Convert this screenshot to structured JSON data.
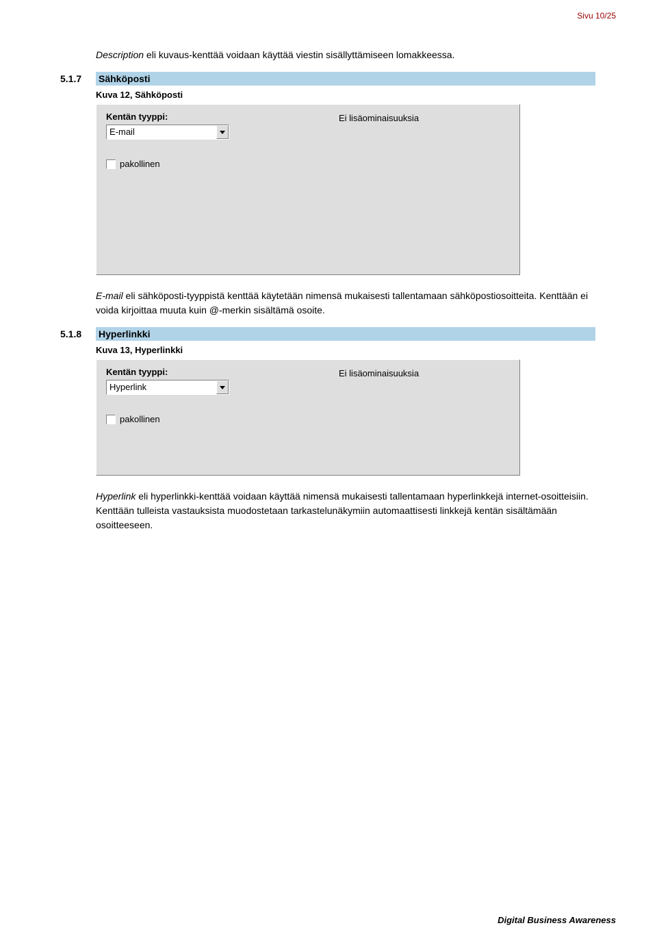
{
  "page_number": "Sivu 10/25",
  "intro_paragraph": {
    "italic": "Description",
    "rest": " eli kuvaus-kenttää voidaan käyttää viestin sisällyttämiseen lomakkeessa."
  },
  "sections": [
    {
      "number": "5.1.7",
      "title": "Sähköposti",
      "caption": "Kuva 12, Sähköposti",
      "panel": {
        "field_label": "Kentän tyyppi:",
        "select_value": "E-mail",
        "checkbox_label": "pakollinen",
        "right_text": "Ei lisäominaisuuksia"
      },
      "paragraph": {
        "italic": "E-mail",
        "rest": " eli sähköposti-tyyppistä kenttää käytetään nimensä mukaisesti tallentamaan sähköpostiosoitteita. Kenttään ei voida kirjoittaa muuta kuin @-merkin sisältämä osoite."
      }
    },
    {
      "number": "5.1.8",
      "title": "Hyperlinkki",
      "caption": "Kuva 13, Hyperlinkki",
      "panel": {
        "field_label": "Kentän tyyppi:",
        "select_value": "Hyperlink",
        "checkbox_label": "pakollinen",
        "right_text": "Ei lisäominaisuuksia"
      },
      "paragraph": {
        "italic": "Hyperlink",
        "rest": " eli hyperlinkki-kenttää voidaan käyttää nimensä mukaisesti tallentamaan hyperlinkkejä internet-osoitteisiin. Kenttään tulleista vastauksista muodostetaan tarkastelunäkymiin automaattisesti linkkejä kentän sisältämään osoitteeseen."
      }
    }
  ],
  "footer": "Digital Business Awareness"
}
